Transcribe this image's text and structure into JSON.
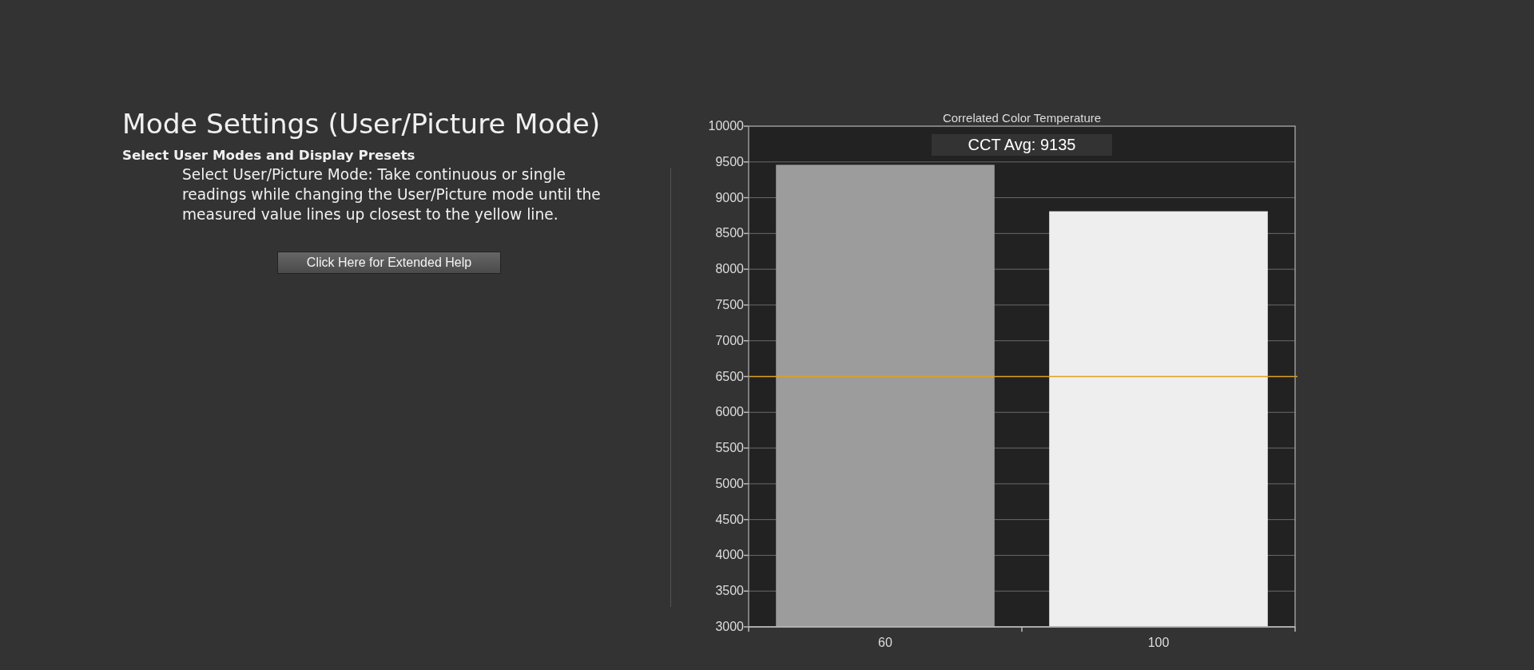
{
  "page": {
    "title": "Mode Settings (User/Picture Mode)",
    "subtitle": "Select User Modes and Display Presets",
    "description": "Select User/Picture Mode: Take continuous or single readings while changing the User/Picture mode until the measured value lines up closest to the yellow line.",
    "help_button": "Click Here for Extended Help"
  },
  "chart": {
    "chart_data": {
      "type": "bar",
      "title": "Correlated Color Temperature",
      "categories": [
        "60",
        "100"
      ],
      "series": [
        {
          "color": "#9c9c9c",
          "values": [
            9460,
            null
          ]
        },
        {
          "color": "#eeeeee",
          "values": [
            null,
            8810
          ]
        }
      ],
      "grid": true,
      "ylim": [
        3000,
        10000
      ],
      "yticks": [
        3000,
        3500,
        4000,
        4500,
        5000,
        5500,
        6000,
        6500,
        7000,
        7500,
        8000,
        8500,
        9000,
        9500,
        10000
      ],
      "ref_lines": [
        {
          "value": 6500,
          "axis": "y",
          "color": "#e0a020"
        }
      ],
      "annotations": [
        {
          "text": "CCT Avg: 9135"
        }
      ]
    }
  }
}
